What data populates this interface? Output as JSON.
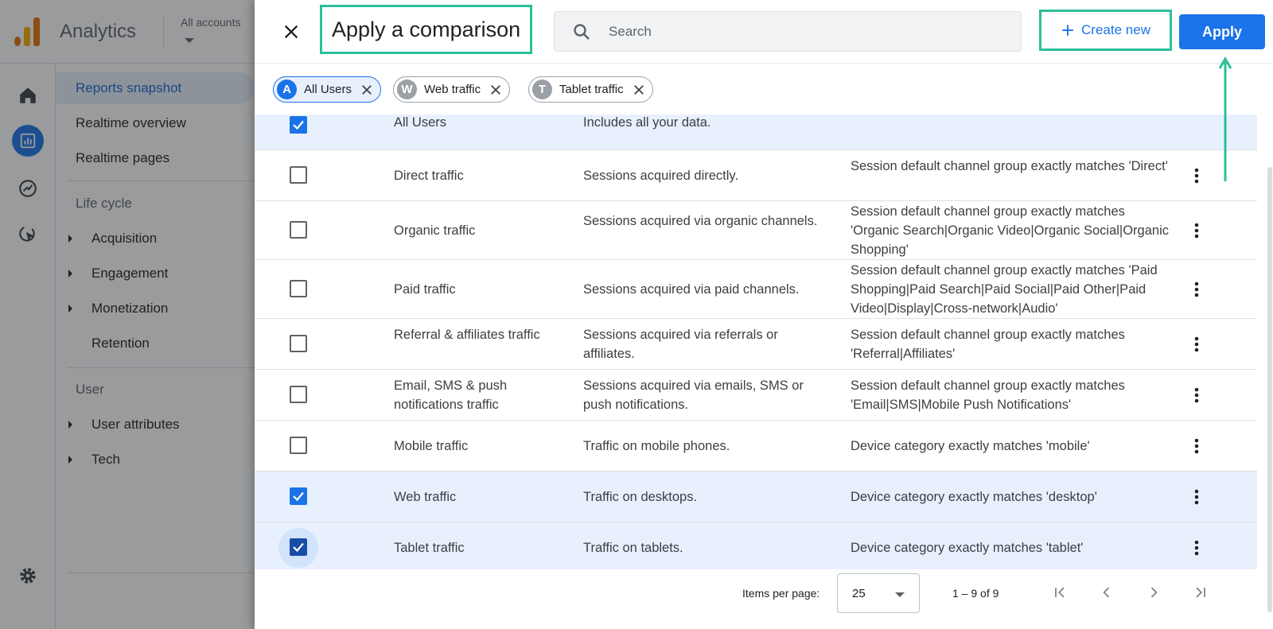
{
  "app": {
    "title": "Analytics",
    "accounts_label": "All accounts"
  },
  "nav": {
    "items": [
      {
        "label": "Reports snapshot",
        "active": true
      },
      {
        "label": "Realtime overview"
      },
      {
        "label": "Realtime pages"
      }
    ],
    "section_lifecycle": "Life cycle",
    "lifecycle_items": [
      "Acquisition",
      "Engagement",
      "Monetization",
      "Retention"
    ],
    "section_user": "User",
    "user_items": [
      "User attributes",
      "Tech"
    ]
  },
  "dialog": {
    "title": "Apply a comparison",
    "search_placeholder": "Search",
    "create_label": "Create new",
    "apply_label": "Apply"
  },
  "chips": [
    {
      "letter": "A",
      "label": "All Users",
      "active": true
    },
    {
      "letter": "W",
      "label": "Web traffic"
    },
    {
      "letter": "T",
      "label": "Tablet traffic"
    }
  ],
  "rows": [
    {
      "name": "All Users",
      "desc": "Includes all your data.",
      "cond": "",
      "checked": true
    },
    {
      "name": "Direct traffic",
      "desc": "Sessions acquired directly.",
      "cond": "Session default channel group exactly matches 'Direct'",
      "checked": false
    },
    {
      "name": "Organic traffic",
      "desc": "Sessions acquired via organic channels.",
      "cond": "Session default channel group exactly matches 'Organic Search|Organic Video|Organic Social|Organic Shopping'",
      "checked": false
    },
    {
      "name": "Paid traffic",
      "desc": "Sessions acquired via paid channels.",
      "cond": "Session default channel group exactly matches 'Paid Shopping|Paid Search|Paid Social|Paid Other|Paid Video|Display|Cross-network|Audio'",
      "checked": false
    },
    {
      "name": "Referral & affiliates traffic",
      "desc": "Sessions acquired via referrals or affiliates.",
      "cond": "Session default channel group exactly matches 'Referral|Affiliates'",
      "checked": false
    },
    {
      "name": "Email, SMS & push notifications traffic",
      "desc": "Sessions acquired via emails, SMS or push notifications.",
      "cond": "Session default channel group exactly matches 'Email|SMS|Mobile Push Notifications'",
      "checked": false
    },
    {
      "name": "Mobile traffic",
      "desc": "Traffic on mobile phones.",
      "cond": "Device category exactly matches 'mobile'",
      "checked": false
    },
    {
      "name": "Web traffic",
      "desc": "Traffic on desktops.",
      "cond": "Device category exactly matches 'desktop'",
      "checked": true
    },
    {
      "name": "Tablet traffic",
      "desc": "Traffic on tablets.",
      "cond": "Device category exactly matches 'tablet'",
      "checked": true
    }
  ],
  "footer": {
    "items_per_page_label": "Items per page:",
    "items_per_page_value": "25",
    "range": "1 – 9 of 9"
  },
  "colors": {
    "accent": "#1a73e8",
    "highlight_box": "#2bbf9a"
  }
}
